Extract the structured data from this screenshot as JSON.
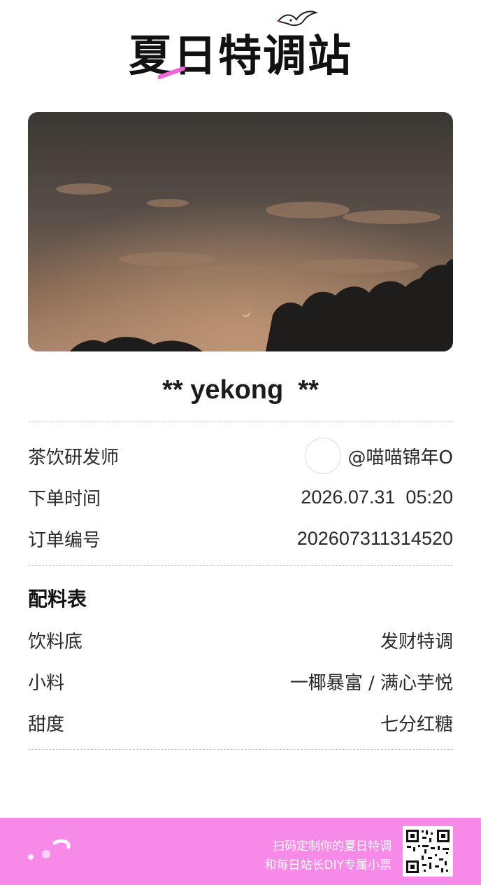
{
  "brand": {
    "logo_text": "夏日特调站"
  },
  "customer": {
    "name_line": "** yekong  **"
  },
  "info": {
    "barista_label": "茶饮研发师",
    "barista_value": "@喵喵锦年O",
    "order_time_label": "下单时间",
    "order_time_value": "2026.07.31  05:20",
    "order_no_label": "订单编号",
    "order_no_value": "202607311314520"
  },
  "recipe": {
    "title": "配料表",
    "base_label": "饮料底",
    "base_value": "发财特调",
    "topping_label": "小料",
    "topping_value": "一椰暴富 / 满心芋悦",
    "sweetness_label": "甜度",
    "sweetness_value": "七分红糖"
  },
  "footer": {
    "line1": "扫码定制你的夏日特调",
    "line2": "和每日站长DIY专属小票",
    "accent_color": "#f78ae9"
  },
  "icons": {
    "bird": "bird-icon",
    "qr": "qr-code-icon",
    "avatar": "avatar-icon"
  }
}
